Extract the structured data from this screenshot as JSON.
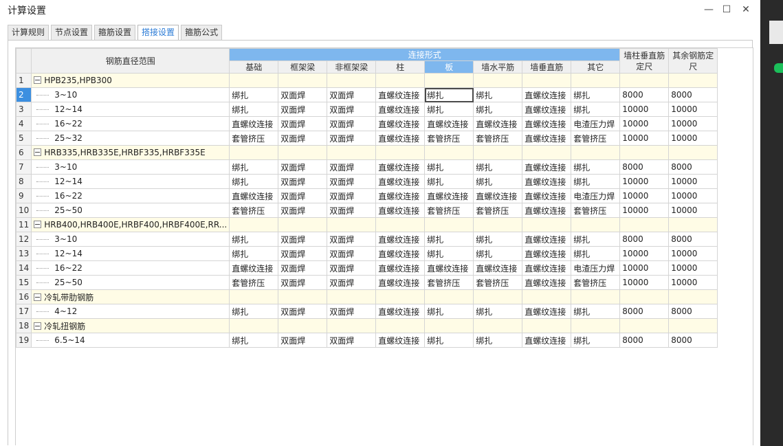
{
  "window": {
    "title": "计算设置",
    "minimize_glyph": "—",
    "maximize_glyph": "☐",
    "close_glyph": "✕"
  },
  "tabs": [
    {
      "label": "计算规则",
      "active": false
    },
    {
      "label": "节点设置",
      "active": false
    },
    {
      "label": "箍筋设置",
      "active": false
    },
    {
      "label": "搭接设置",
      "active": true
    },
    {
      "label": "箍筋公式",
      "active": false
    }
  ],
  "grid": {
    "header": {
      "range_label": "钢筋直径范围",
      "group_label": "连接形式",
      "sub_columns": [
        "基础",
        "框架梁",
        "非框架梁",
        "柱",
        "板",
        "墙水平筋",
        "墙垂直筋",
        "其它"
      ],
      "extra_columns": [
        "墙柱垂直筋定尺",
        "其余钢筋定尺"
      ]
    },
    "rows": [
      {
        "num": "1",
        "group": true,
        "label": "HPB235,HPB300",
        "cells": []
      },
      {
        "num": "2",
        "label": "3~10",
        "cells": [
          "绑扎",
          "双面焊",
          "双面焊",
          "直螺纹连接",
          "绑扎",
          "绑扎",
          "直螺纹连接",
          "绑扎",
          "8000",
          "8000"
        ]
      },
      {
        "num": "3",
        "label": "12~14",
        "cells": [
          "绑扎",
          "双面焊",
          "双面焊",
          "直螺纹连接",
          "绑扎",
          "绑扎",
          "直螺纹连接",
          "绑扎",
          "10000",
          "10000"
        ]
      },
      {
        "num": "4",
        "label": "16~22",
        "cells": [
          "直螺纹连接",
          "双面焊",
          "双面焊",
          "直螺纹连接",
          "直螺纹连接",
          "直螺纹连接",
          "直螺纹连接",
          "电渣压力焊",
          "10000",
          "10000"
        ]
      },
      {
        "num": "5",
        "label": "25~32",
        "cells": [
          "套管挤压",
          "双面焊",
          "双面焊",
          "直螺纹连接",
          "套管挤压",
          "套管挤压",
          "直螺纹连接",
          "套管挤压",
          "10000",
          "10000"
        ]
      },
      {
        "num": "6",
        "group": true,
        "label": "HRB335,HRB335E,HRBF335,HRBF335E",
        "cells": []
      },
      {
        "num": "7",
        "label": "3~10",
        "cells": [
          "绑扎",
          "双面焊",
          "双面焊",
          "直螺纹连接",
          "绑扎",
          "绑扎",
          "直螺纹连接",
          "绑扎",
          "8000",
          "8000"
        ]
      },
      {
        "num": "8",
        "label": "12~14",
        "cells": [
          "绑扎",
          "双面焊",
          "双面焊",
          "直螺纹连接",
          "绑扎",
          "绑扎",
          "直螺纹连接",
          "绑扎",
          "10000",
          "10000"
        ]
      },
      {
        "num": "9",
        "label": "16~22",
        "cells": [
          "直螺纹连接",
          "双面焊",
          "双面焊",
          "直螺纹连接",
          "直螺纹连接",
          "直螺纹连接",
          "直螺纹连接",
          "电渣压力焊",
          "10000",
          "10000"
        ]
      },
      {
        "num": "10",
        "label": "25~50",
        "cells": [
          "套管挤压",
          "双面焊",
          "双面焊",
          "直螺纹连接",
          "套管挤压",
          "套管挤压",
          "直螺纹连接",
          "套管挤压",
          "10000",
          "10000"
        ]
      },
      {
        "num": "11",
        "group": true,
        "label": "HRB400,HRB400E,HRBF400,HRBF400E,RR...",
        "cells": []
      },
      {
        "num": "12",
        "label": "3~10",
        "cells": [
          "绑扎",
          "双面焊",
          "双面焊",
          "直螺纹连接",
          "绑扎",
          "绑扎",
          "直螺纹连接",
          "绑扎",
          "8000",
          "8000"
        ]
      },
      {
        "num": "13",
        "label": "12~14",
        "cells": [
          "绑扎",
          "双面焊",
          "双面焊",
          "直螺纹连接",
          "绑扎",
          "绑扎",
          "直螺纹连接",
          "绑扎",
          "10000",
          "10000"
        ]
      },
      {
        "num": "14",
        "label": "16~22",
        "cells": [
          "直螺纹连接",
          "双面焊",
          "双面焊",
          "直螺纹连接",
          "直螺纹连接",
          "直螺纹连接",
          "直螺纹连接",
          "电渣压力焊",
          "10000",
          "10000"
        ]
      },
      {
        "num": "15",
        "label": "25~50",
        "cells": [
          "套管挤压",
          "双面焊",
          "双面焊",
          "直螺纹连接",
          "套管挤压",
          "套管挤压",
          "直螺纹连接",
          "套管挤压",
          "10000",
          "10000"
        ]
      },
      {
        "num": "16",
        "group": true,
        "label": "冷轧带肋钢筋",
        "cells": []
      },
      {
        "num": "17",
        "label": "4~12",
        "cells": [
          "绑扎",
          "双面焊",
          "双面焊",
          "直螺纹连接",
          "绑扎",
          "绑扎",
          "直螺纹连接",
          "绑扎",
          "8000",
          "8000"
        ]
      },
      {
        "num": "18",
        "group": true,
        "label": "冷轧扭钢筋",
        "cells": []
      },
      {
        "num": "19",
        "label": "6.5~14",
        "cells": [
          "绑扎",
          "双面焊",
          "双面焊",
          "直螺纹连接",
          "绑扎",
          "绑扎",
          "直螺纹连接",
          "绑扎",
          "8000",
          "8000"
        ]
      }
    ],
    "active_row": "2",
    "active_column": "板"
  },
  "colors": {
    "accent": "#7eb7ee",
    "row_highlight": "#3c8fe0",
    "group_row_bg": "#fffce6",
    "tab_active_text": "#2b7bd6"
  }
}
